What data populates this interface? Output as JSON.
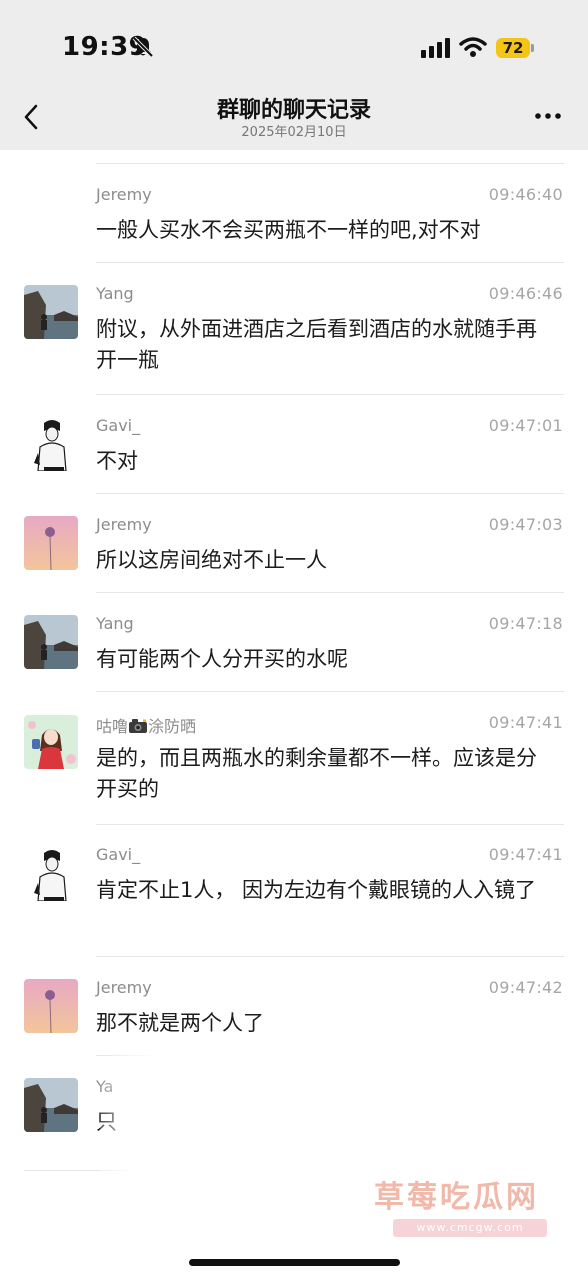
{
  "status_bar": {
    "time": "19:39",
    "battery": "72"
  },
  "nav": {
    "title": "群聊的聊天记录",
    "subtitle": "2025年02月10日"
  },
  "messages": [
    {
      "sender": "Jeremy",
      "time": "09:46:40",
      "text": "一般人买水不会买两瓶不一样的吧,对不对"
    },
    {
      "sender": "Yang",
      "time": "09:46:46",
      "text": "附议，从外面进酒店之后看到酒店的水就随手再开一瓶"
    },
    {
      "sender": "Gavi_",
      "time": "09:47:01",
      "text": "不对"
    },
    {
      "sender": "Jeremy",
      "time": "09:47:03",
      "text": "所以这房间绝对不止一人"
    },
    {
      "sender": "Yang",
      "time": "09:47:18",
      "text": "有可能两个人分开买的水呢"
    },
    {
      "sender_prefix": "咕噜",
      "sender_suffix": "涂防晒",
      "time": "09:47:41",
      "text": "是的，而且两瓶水的剩余量都不一样。应该是分开买的"
    },
    {
      "sender": "Gavi_",
      "time": "09:47:41",
      "text": "肯定不止1人， 因为左边有个戴眼镜的人入镜了"
    },
    {
      "sender": "Jeremy",
      "time": "09:47:42",
      "text": "那不就是两个人了"
    },
    {
      "sender": "Ya",
      "time": "",
      "text": "只"
    }
  ],
  "watermark": {
    "name": "草莓吃瓜网",
    "url": "www.cmcgw.com"
  },
  "colors": {
    "header_bg": "#ededed",
    "battery": "#f5c516",
    "watermark": "#f0b9aa"
  }
}
